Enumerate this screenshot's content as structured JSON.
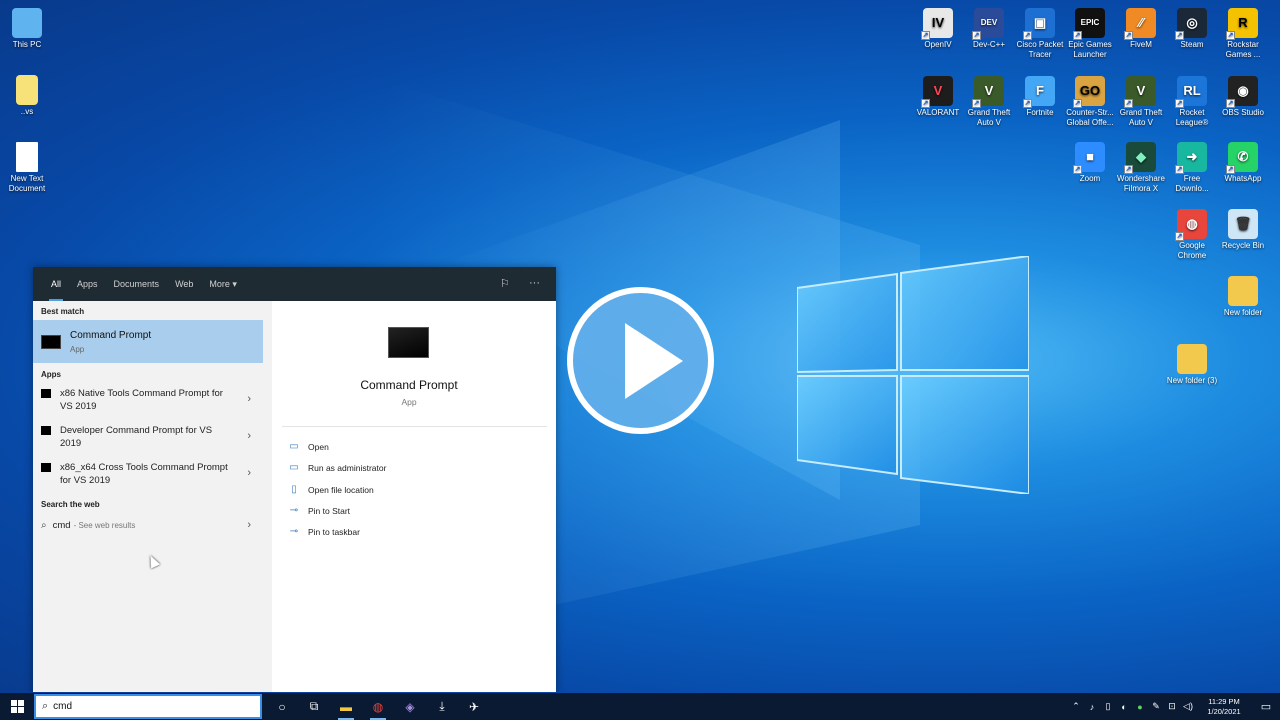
{
  "desktop": {
    "left_icons": [
      {
        "label": "This PC",
        "icon": "pc-icon"
      },
      {
        "label": "..vs",
        "icon": "folder-icon"
      },
      {
        "label": "New Text Document",
        "icon": "text-document-icon"
      }
    ],
    "right_icons": [
      {
        "label": "OpenIV",
        "glyph": "IV",
        "color": "#e8e8e8",
        "fg": "#000"
      },
      {
        "label": "Dev-C++",
        "glyph": "DEV",
        "color": "#2a4a9a",
        "fg": "#fff"
      },
      {
        "label": "Cisco Packet Tracer",
        "glyph": "▣",
        "color": "#1d6fd1",
        "fg": "#fff"
      },
      {
        "label": "Epic Games Launcher",
        "glyph": "EPIC",
        "color": "#111",
        "fg": "#fff"
      },
      {
        "label": "FiveM",
        "glyph": "∕∕",
        "color": "#f08a24",
        "fg": "#fff"
      },
      {
        "label": "Steam",
        "glyph": "◎",
        "color": "#1b2838",
        "fg": "#fff"
      },
      {
        "label": "Rockstar Games ...",
        "glyph": "R",
        "color": "#f4c200",
        "fg": "#000"
      },
      {
        "label": "VALORANT",
        "glyph": "V",
        "color": "#1d1d1d",
        "fg": "#ff4655"
      },
      {
        "label": "Grand Theft Auto V",
        "glyph": "V",
        "color": "#3a5a2a",
        "fg": "#fff"
      },
      {
        "label": "Fortnite",
        "glyph": "F",
        "color": "#43a7f5",
        "fg": "#fff"
      },
      {
        "label": "Counter-Str... Global Offe...",
        "glyph": "GO",
        "color": "#d9a441",
        "fg": "#000"
      },
      {
        "label": "Grand Theft Auto V",
        "glyph": "V",
        "color": "#3a5a2a",
        "fg": "#fff"
      },
      {
        "label": "Rocket League®",
        "glyph": "RL",
        "color": "#1c75d8",
        "fg": "#fff"
      },
      {
        "label": "OBS Studio",
        "glyph": "◉",
        "color": "#222",
        "fg": "#fff"
      },
      {
        "label": "Zoom",
        "glyph": "■",
        "color": "#2d8cff",
        "fg": "#fff"
      },
      {
        "label": "Wondershare Filmora X",
        "glyph": "◆",
        "color": "#1a4a3a",
        "fg": "#7ff0c0"
      },
      {
        "label": "Free Downlo...",
        "glyph": "➜",
        "color": "#18b8a0",
        "fg": "#fff"
      },
      {
        "label": "WhatsApp",
        "glyph": "✆",
        "color": "#25d366",
        "fg": "#fff"
      },
      {
        "label": "Google Chrome",
        "glyph": "◍",
        "color": "#e8453c",
        "fg": "#fff"
      },
      {
        "label": "Recycle Bin",
        "glyph": "🗑",
        "color": "#cfe6f7",
        "fg": "#333"
      },
      {
        "label": "New folder",
        "glyph": "",
        "color": "#f2c94c",
        "fg": "#000"
      },
      {
        "label": "New folder (3)",
        "glyph": "",
        "color": "#f2c94c",
        "fg": "#000"
      }
    ]
  },
  "search": {
    "tabs": [
      "All",
      "Apps",
      "Documents",
      "Web",
      "More ▾"
    ],
    "best_match_title": "Best match",
    "best_match": {
      "name": "Command Prompt",
      "type": "App"
    },
    "apps_title": "Apps",
    "apps": [
      "x86 Native Tools Command Prompt for VS 2019",
      "Developer Command Prompt for VS 2019",
      "x86_x64 Cross Tools Command Prompt for VS 2019"
    ],
    "web_title": "Search the web",
    "web_query": "cmd",
    "web_hint": "- See web results",
    "preview": {
      "name": "Command Prompt",
      "type": "App",
      "actions": [
        "Open",
        "Run as administrator",
        "Open file location",
        "Pin to Start",
        "Pin to taskbar"
      ]
    },
    "input_value": "cmd"
  },
  "taskbar": {
    "clock_time": "11:29 PM",
    "clock_date": "1/20/2021"
  },
  "colors": {
    "accent": "#4aa0e6",
    "selected_row": "#a9cdec",
    "taskbar": "#0b1a33",
    "panel_header": "#1f2b33"
  }
}
